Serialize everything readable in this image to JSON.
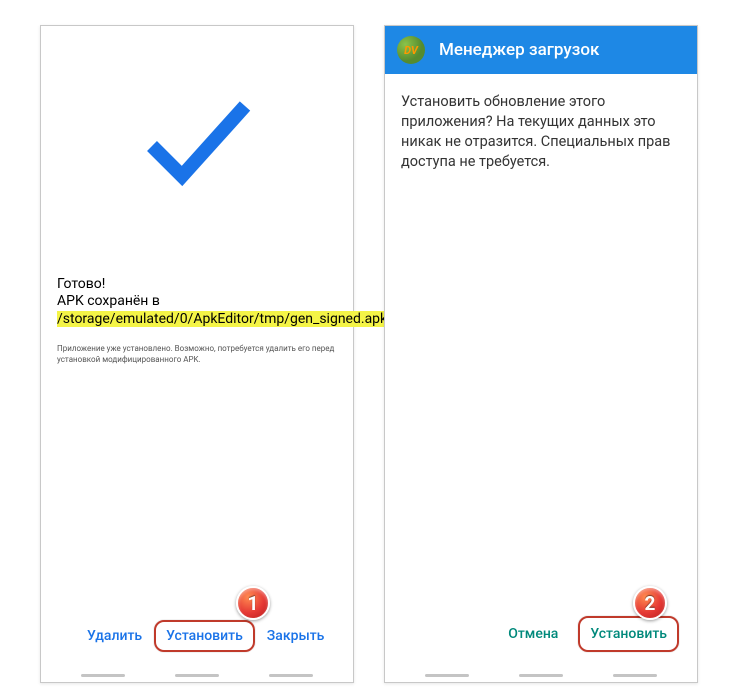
{
  "phone1": {
    "status": "Готово!",
    "path_prefix": "APK сохранён в ",
    "path_highlighted": "/storage/emulated/0/ApkEditor/tmp/gen_signed.apk",
    "note": "Приложение уже установлено. Возможно, потребуется удалить его перед установкой модифицированного APK.",
    "buttons": {
      "delete": "Удалить",
      "install": "Установить",
      "close": "Закрыть"
    },
    "badge": "1"
  },
  "phone2": {
    "header": {
      "icon_text": "DV",
      "title": "Менеджер загрузок"
    },
    "body": "Установить обновление этого приложения? На текущих данных это никак не отразится. Специальных прав доступа не требуется.",
    "buttons": {
      "cancel": "Отмена",
      "install": "Установить"
    },
    "badge": "2"
  },
  "colors": {
    "accent_blue": "#1a73e8",
    "header_blue": "#1e88e5",
    "accent_teal": "#00897b",
    "highlight_yellow": "#f4f447",
    "badge_red": "#e53935"
  }
}
